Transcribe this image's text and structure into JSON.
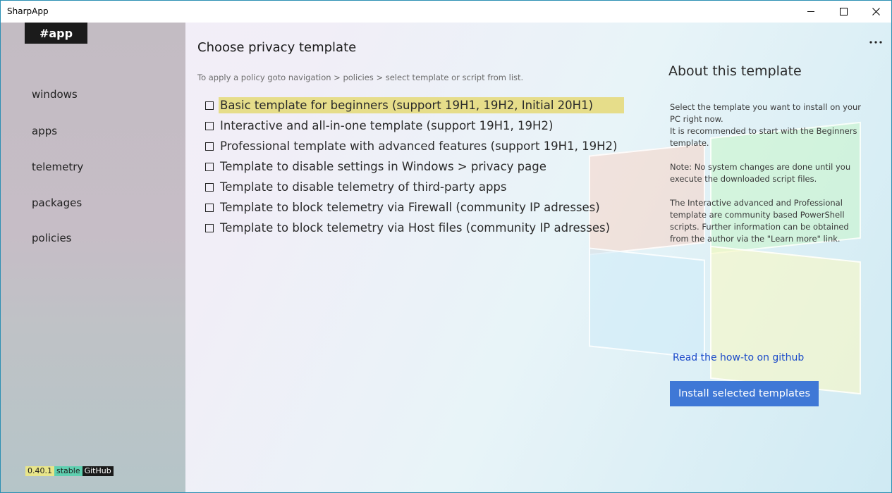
{
  "window": {
    "title": "SharpApp",
    "controls": [
      "minimize",
      "maximize",
      "close"
    ]
  },
  "sidebar": {
    "app_badge": "#app",
    "items": [
      {
        "label": "windows"
      },
      {
        "label": "apps"
      },
      {
        "label": "telemetry"
      },
      {
        "label": "packages"
      },
      {
        "label": "policies"
      }
    ],
    "version": {
      "number": "0.40.1",
      "channel": "stable",
      "github": "GitHub"
    }
  },
  "main": {
    "more_icon": "ellipsis-icon",
    "title": "Choose privacy template",
    "hint": "To apply a policy goto navigation > policies > select template or script from list.",
    "templates": [
      {
        "label": "Basic template for beginners (support 19H1, 19H2, Initial 20H1)",
        "checked": false,
        "selected": true
      },
      {
        "label": "Interactive and all-in-one template (support 19H1, 19H2)",
        "checked": false,
        "selected": false
      },
      {
        "label": "Professional template with advanced features (support 19H1, 19H2)",
        "checked": false,
        "selected": false
      },
      {
        "label": "Template to disable settings in Windows > privacy page",
        "checked": false,
        "selected": false
      },
      {
        "label": "Template to disable telemetry of third-party apps",
        "checked": false,
        "selected": false
      },
      {
        "label": "Template to block telemetry via Firewall (community IP adresses)",
        "checked": false,
        "selected": false
      },
      {
        "label": "Template to block telemetry via Host files (community IP adresses)",
        "checked": false,
        "selected": false
      }
    ]
  },
  "about": {
    "title": "About this template",
    "paragraphs": [
      "Select the template you want to install on your PC right now.\nIt is recommended to start with the Beginners template.",
      "Note: No system changes are done until you execute the downloaded script files.",
      "The Interactive advanced and Professional template are community based PowerShell scripts. Further information can be obtained from the author via the \"Learn more\" link."
    ],
    "link": "Read the how-to on github",
    "install_button": "Install selected templates"
  },
  "colors": {
    "accent": "#3f78d6",
    "selection": "#e6dd8a",
    "link": "#1a49c9",
    "badge_version": "#e8e58a",
    "badge_stable": "#5fcfb0",
    "badge_github": "#1a1a1a"
  }
}
